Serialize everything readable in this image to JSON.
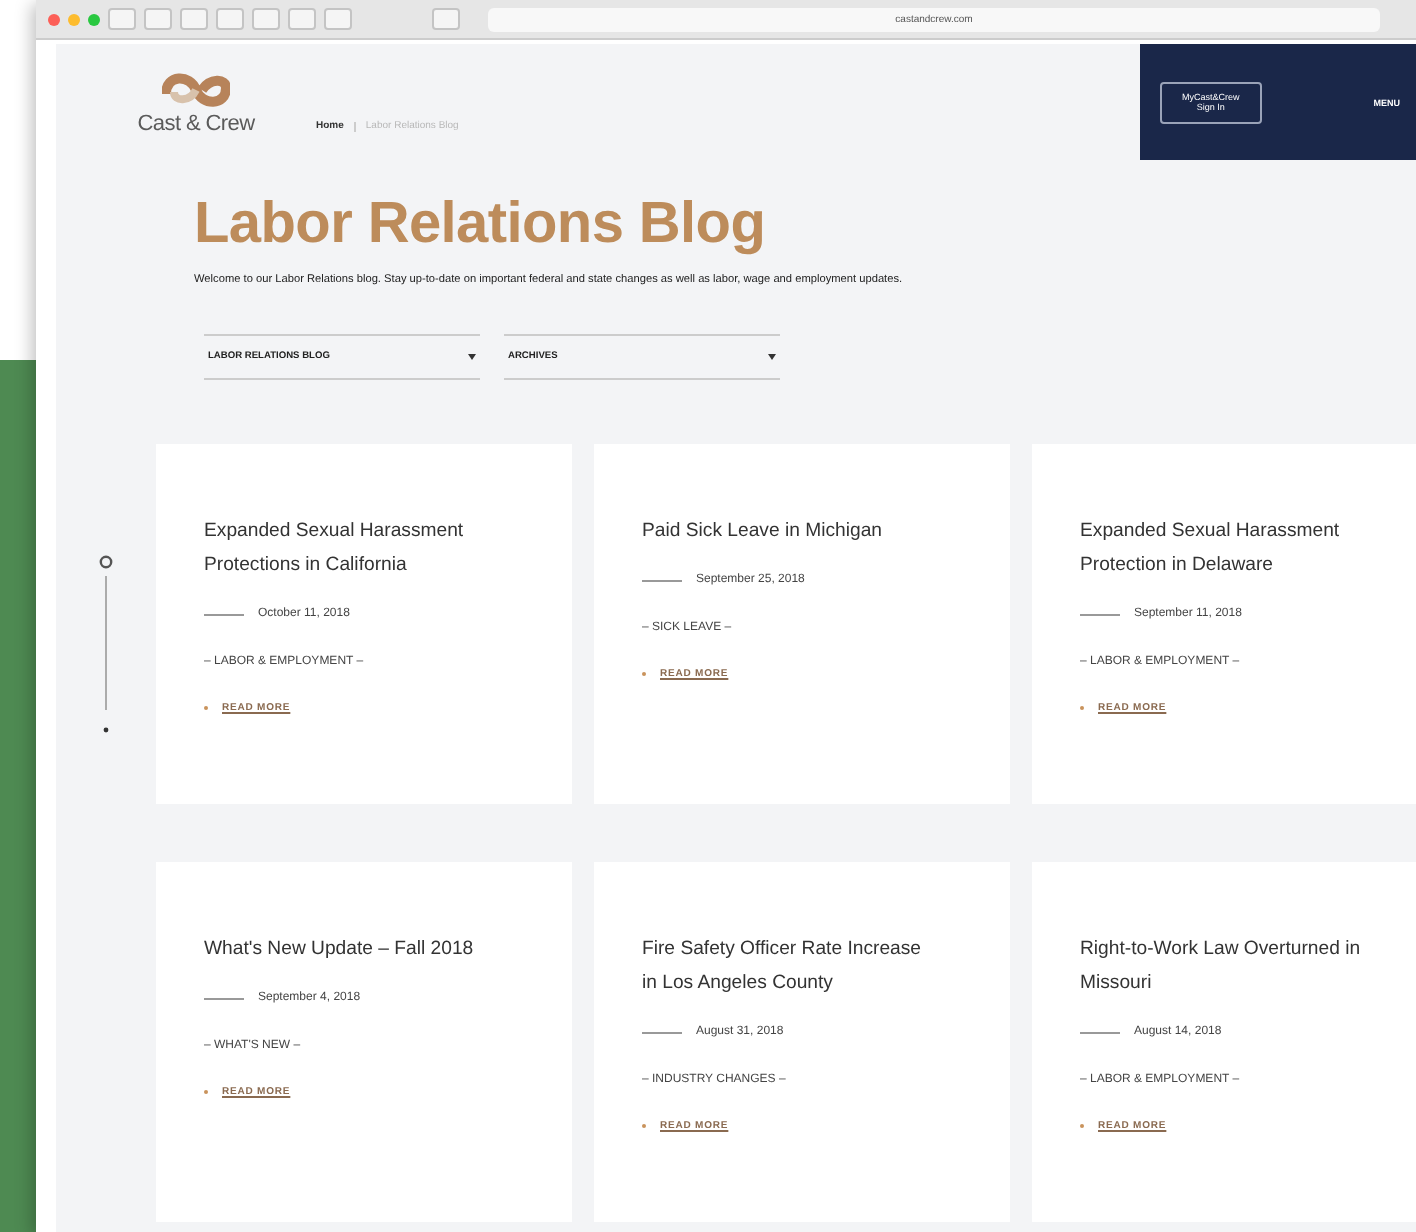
{
  "browser": {
    "url": "castandcrew.com"
  },
  "header": {
    "logo_text": "Cast & Crew",
    "breadcrumb": [
      {
        "label": "Home",
        "current": false
      },
      {
        "label": "Labor Relations Blog",
        "current": true
      }
    ],
    "sign_in": [
      "MyCast&Crew",
      "Sign In"
    ],
    "menu": "MENU"
  },
  "page": {
    "title": "Labor Relations Blog",
    "description": "Welcome to our Labor Relations blog. Stay up-to-date on important federal and state changes as well as labor, wage and employment updates.",
    "filters": [
      {
        "label": "LABOR RELATIONS BLOG"
      },
      {
        "label": "ARCHIVES"
      }
    ],
    "posts": [
      {
        "title": "Expanded Sexual Harassment Protections in California",
        "date": "October 11, 2018",
        "tag": "– LABOR & EMPLOYMENT –",
        "link": "READ MORE"
      },
      {
        "title": "Paid Sick Leave in Michigan",
        "date": "September 25, 2018",
        "tag": "– SICK LEAVE –",
        "link": "READ MORE"
      },
      {
        "title": "Expanded Sexual Harassment Protection in Delaware",
        "date": "September 11, 2018",
        "tag": "– LABOR & EMPLOYMENT –",
        "link": "READ MORE"
      },
      {
        "title": "What's New Update – Fall 2018",
        "date": "September 4, 2018",
        "tag": "– WHAT'S NEW –",
        "link": "READ MORE"
      },
      {
        "title": "Fire Safety Officer Rate Increase in Los Angeles County",
        "date": "August 31, 2018",
        "tag": "– INDUSTRY CHANGES –",
        "link": "READ MORE"
      },
      {
        "title": "Right-to-Work Law Overturned in Missouri",
        "date": "August 14, 2018",
        "tag": "– LABOR & EMPLOYMENT –",
        "link": "READ MORE"
      }
    ]
  }
}
